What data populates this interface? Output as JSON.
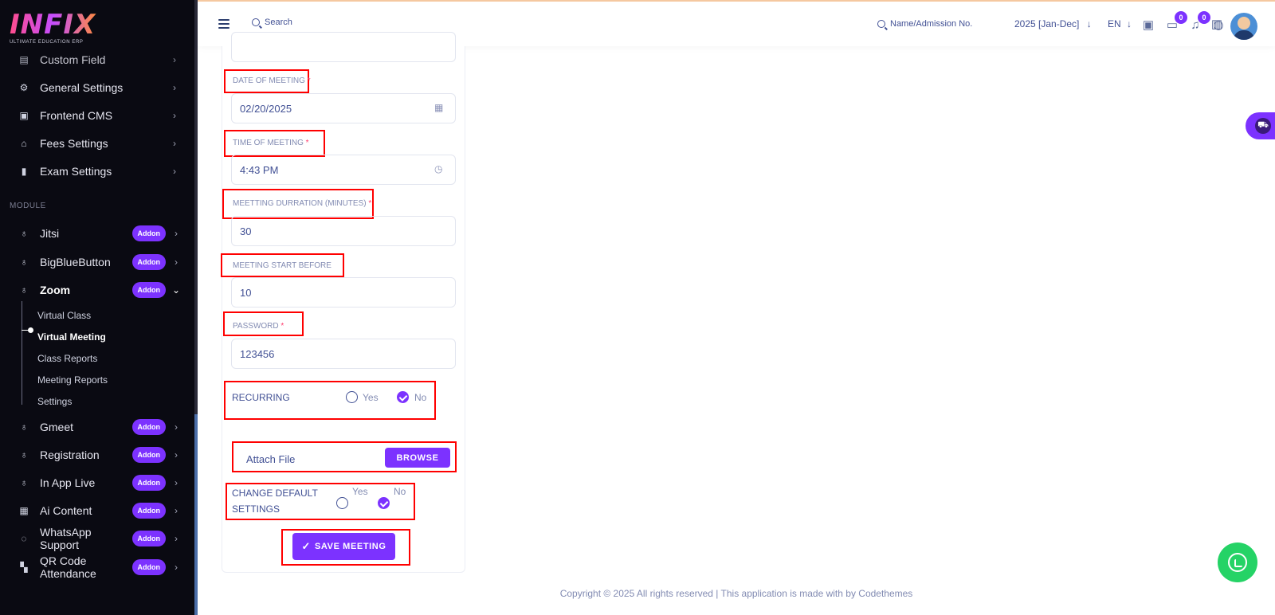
{
  "brand": {
    "logo_text": "INFIX",
    "logo_sub": "ULTIMATE EDUCATION ERP"
  },
  "sidebar": {
    "items": [
      {
        "label": "Custom Field",
        "icon": "custom-field-icon"
      },
      {
        "label": "General Settings",
        "icon": "gears-icon"
      },
      {
        "label": "Frontend CMS",
        "icon": "cms-icon"
      },
      {
        "label": "Fees Settings",
        "icon": "bank-icon"
      },
      {
        "label": "Exam Settings",
        "icon": "book-icon"
      }
    ],
    "section_label": "MODULE",
    "modules": [
      {
        "label": "Jitsi",
        "badge": "Addon"
      },
      {
        "label": "BigBlueButton",
        "badge": "Addon"
      },
      {
        "label": "Zoom",
        "badge": "Addon"
      },
      {
        "label": "Gmeet",
        "badge": "Addon"
      },
      {
        "label": "Registration",
        "badge": "Addon"
      },
      {
        "label": "In App Live",
        "badge": "Addon"
      },
      {
        "label": "Ai Content",
        "badge": "Addon"
      },
      {
        "label": "WhatsApp Support",
        "badge": "Addon"
      },
      {
        "label": "QR Code Attendance",
        "badge": "Addon"
      }
    ],
    "zoom_sub": [
      "Virtual Class",
      "Virtual Meeting",
      "Class Reports",
      "Meeting Reports",
      "Settings"
    ],
    "active_sub": "Virtual Meeting"
  },
  "header": {
    "search_placeholder": "Search",
    "name_search": "Name/Admission No.",
    "session": "2025 [Jan-Dec]",
    "session_arrow": "↓",
    "language": "EN",
    "language_arrow": "↓",
    "messages_count": "0",
    "notifications_count": "0"
  },
  "form": {
    "date_label": "DATE OF MEETING",
    "date_value": "02/20/2025",
    "time_label": "TIME OF MEETING",
    "time_value": "4:43 PM",
    "duration_label": "MEETTING DURRATION (MINUTES)",
    "duration_value": "30",
    "start_before_label": "MEETING START BEFORE",
    "start_before_value": "10",
    "password_label": "PASSWORD",
    "password_value": "123456",
    "required_mark": "*",
    "recurring_label": "RECURRING",
    "recurring_yes": "Yes",
    "recurring_no": "No",
    "recurring_selected": "No",
    "attach_label": "Attach File",
    "browse_label": "BROWSE",
    "change_default_label_1": "CHANGE DEFAULT",
    "change_default_label_2": "SETTINGS",
    "change_default_yes": "Yes",
    "change_default_no": "No",
    "change_default_selected": "No",
    "save_label": "SAVE MEETING",
    "save_check": "✓"
  },
  "footer": {
    "text": "Copyright © 2025 All rights reserved | This application is made with by Codethemes"
  },
  "colors": {
    "accent": "#7c32ff",
    "sidebar_bg": "#0a0a12",
    "highlight": "#ff0000",
    "whatsapp": "#25d366"
  }
}
